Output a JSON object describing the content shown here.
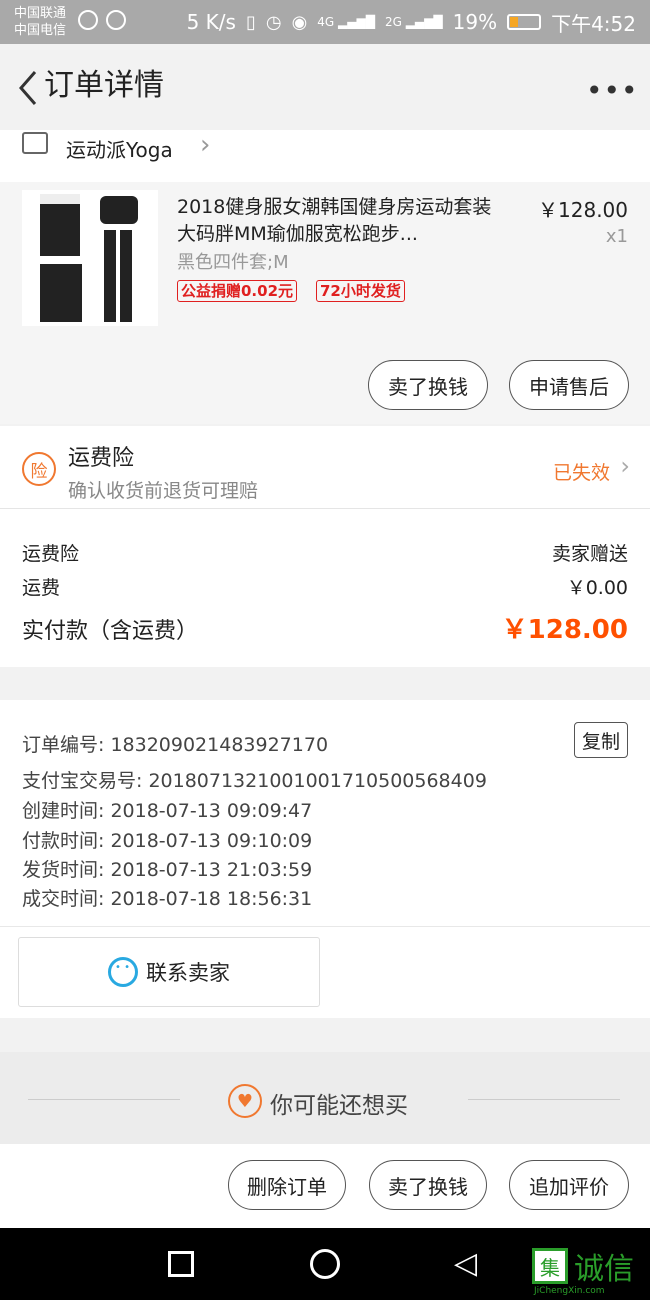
{
  "status_bar": {
    "carrier1": "中国联通",
    "carrier2": "中国电信",
    "speed": "5 K/s",
    "net1": "4G",
    "net2": "2G",
    "battery": "19%",
    "time": "下午4:52"
  },
  "header": {
    "title": "订单详情",
    "more": "•••"
  },
  "shop": {
    "name": "运动派Yoga"
  },
  "product": {
    "title": "2018健身服女潮韩国健身房运动套装大码胖MM瑜伽服宽松跑步...",
    "sku": "黑色四件套;M",
    "tags": [
      "公益捐赠0.02元",
      "72小时发货"
    ],
    "price": "￥128.00",
    "qty": "x1",
    "buttons": [
      "卖了换钱",
      "申请售后"
    ]
  },
  "insurance": {
    "badge": "险",
    "title": "运费险",
    "subtitle": "确认收货前退货可理赔",
    "status": "已失效"
  },
  "summary": {
    "rows": [
      {
        "label": "运费险",
        "value": "卖家赠送"
      },
      {
        "label": "运费",
        "value": "￥0.00"
      }
    ],
    "total_label": "实付款（含运费）",
    "total_value": "￥128.00"
  },
  "order_info": {
    "lines": [
      "订单编号: 183209021483927170",
      "支付宝交易号: 2018071321001001710500568409",
      "创建时间: 2018-07-13 09:09:47",
      "付款时间: 2018-07-13 09:10:09",
      "发货时间: 2018-07-13 21:03:59",
      "成交时间: 2018-07-18 18:56:31"
    ],
    "copy_label": "复制",
    "contact_label": "联系卖家"
  },
  "recommend": {
    "title": "你可能还想买"
  },
  "actions": [
    "删除订单",
    "卖了换钱",
    "追加评价"
  ],
  "watermark": {
    "glyph": "集",
    "text": "诚信",
    "url": "JiChengXin.com"
  },
  "colors": {
    "accent": "#ff5000",
    "orange": "#f07830",
    "tag_red": "#e02020"
  }
}
